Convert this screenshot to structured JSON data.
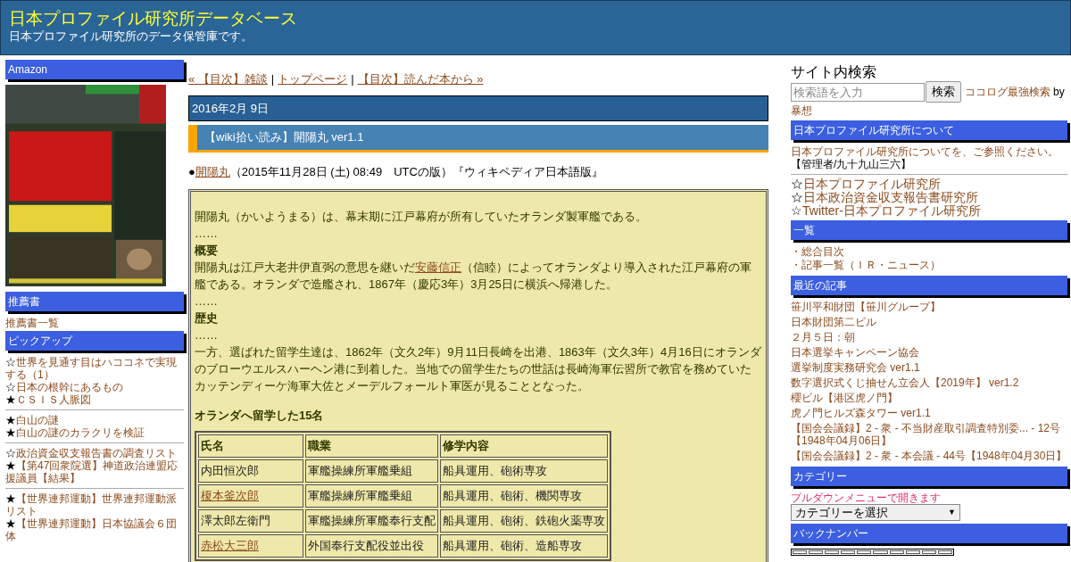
{
  "header": {
    "title": "日本プロファイル研究所データベース",
    "subtitle": "日本プロファイル研究所のデータ保管庫です。"
  },
  "left": {
    "sections": [
      {
        "heading": "Amazon",
        "kind": "picture"
      },
      {
        "heading": "推薦書",
        "kind": "links",
        "groups": [
          [
            {
              "text": "推薦書一覧"
            }
          ]
        ]
      },
      {
        "heading": "ピックアップ",
        "kind": "links",
        "groups": [
          [
            {
              "mark": "☆",
              "text": "世界を見通す目はハココネで実現する（1）"
            },
            {
              "mark": "☆",
              "text": "日本の根幹にあるもの"
            },
            {
              "mark": "★",
              "text": "ＣＳＩＳ人脈図"
            }
          ],
          [
            {
              "mark": "★",
              "text": "白山の謎"
            },
            {
              "mark": "★",
              "text": "白山の謎のカラクリを検証"
            }
          ],
          [
            {
              "mark": "☆",
              "text": "政治資金収支報告書の調査リスト"
            },
            {
              "mark": "★",
              "text": "【第47回衆院選】神道政治連盟応援議員【結果】"
            }
          ],
          [
            {
              "mark": "★",
              "text": "【世界連邦運動】世界連邦運動派リスト"
            },
            {
              "mark": "★",
              "text": "【世界連邦運動】日本協議会６団体"
            }
          ]
        ]
      }
    ]
  },
  "main": {
    "nav": {
      "separator": "|",
      "links": [
        "« 【目次】雑談",
        "トップページ",
        "【目次】読んだ本から »"
      ]
    },
    "date": "2016年2月 9日",
    "entry_title": "【wiki拾い読み】開陽丸 ver1.1",
    "source": {
      "bullet": "●",
      "link": "開陽丸",
      "rest": "（2015年11月28日 (土) 08:49　UTCの版）『ウィキペディア日本語版』"
    },
    "quote": [
      {
        "kind": "gap"
      },
      {
        "kind": "text",
        "parts": [
          {
            "text": "開陽丸（かいようまる）は、幕末期に江戸幕府が所有していたオランダ製軍艦である。",
            "link": false
          }
        ]
      },
      {
        "kind": "text",
        "parts": [
          {
            "text": "……",
            "link": false
          }
        ]
      },
      {
        "kind": "heading",
        "text": "概要"
      },
      {
        "kind": "text",
        "parts": [
          {
            "text": "開陽丸は江戸大老井伊直弼の意思を継いだ",
            "link": false
          },
          {
            "text": "安藤信正",
            "link": true
          },
          {
            "text": "（信睦）によってオランダより導入された江戸幕府の軍艦である。オランダで造艦され、1867年（慶応3年）3月25日に横浜へ帰港した。",
            "link": false
          }
        ]
      },
      {
        "kind": "text",
        "parts": [
          {
            "text": "……",
            "link": false
          }
        ]
      },
      {
        "kind": "heading",
        "text": "歴史"
      },
      {
        "kind": "text",
        "parts": [
          {
            "text": "……",
            "link": false
          }
        ]
      },
      {
        "kind": "text",
        "parts": [
          {
            "text": "一方、選ばれた留学生達は、1862年（文久2年）9月11日長崎を出港、1863年（文久3年）4月16日にオランダのブローウエルスハーヘン港に到着した。当地での留学生たちの世話は長崎海軍伝習所で教官を務めていたカッテンディーケ海軍大佐とメーデルフォールト軍医が見ることとなった。",
            "link": false
          }
        ]
      },
      {
        "kind": "gap"
      },
      {
        "kind": "heading",
        "text": "オランダへ留学した15名"
      },
      {
        "kind": "table",
        "columns": [
          "氏名",
          "職業",
          "修学内容"
        ],
        "rows": [
          [
            {
              "text": "内田恒次郎",
              "link": false
            },
            {
              "text": "軍艦操練所軍艦乗組",
              "link": false
            },
            {
              "text": "船具運用、砲術専攻",
              "link": false
            }
          ],
          [
            {
              "text": "榎本釜次郎",
              "link": true
            },
            {
              "text": "軍艦操練所軍艦乗組",
              "link": false
            },
            {
              "text": "船具運用、砲術、機関専攻",
              "link": false
            }
          ],
          [
            {
              "text": "澤太郎左衛門",
              "link": false
            },
            {
              "text": "軍艦操練所軍艦奉行支配",
              "link": false
            },
            {
              "text": "船具運用、砲術、鉄砲火薬専攻",
              "link": false
            }
          ],
          [
            {
              "text": "赤松大三郎",
              "link": true
            },
            {
              "text": "外国奉行支配役並出役",
              "link": false
            },
            {
              "text": "船具運用、砲術、造船専攻",
              "link": false
            }
          ]
        ]
      }
    ]
  },
  "right": {
    "search": {
      "title": "サイト内検索",
      "placeholder": "検索語を入力",
      "button": "検索",
      "credit_link": "ココログ最強検索",
      "credit_by": "by",
      "credit_author": "暴想"
    },
    "about": {
      "heading": "日本プロファイル研究所について",
      "link": "日本プロファイル研究所について",
      "text": "を、ご参照ください。",
      "admin": "【管理者/九十九山三六】"
    },
    "sites": [
      {
        "mark": "☆",
        "text": "日本プロファイル研究所"
      },
      {
        "mark": "☆",
        "text": "日本政治資金収支報告書研究所"
      },
      {
        "mark": "☆",
        "text": "Twitter-日本プロファイル研究所"
      }
    ],
    "index": {
      "heading": "一覧",
      "items": [
        "・総合目次",
        "・記事一覧（ＩＲ・ニュース）"
      ]
    },
    "recent": {
      "heading": "最近の記事",
      "items": [
        "笹川平和財団【笹川グループ】",
        "日本財団第二ビル",
        "２月５日：朝",
        "日本選挙キャンペーン協会",
        "選挙制度実務研究会 ver1.1",
        "数字選択式くじ抽せん立会人【2019年】 ver1.2",
        "櫻ビル【港区虎ノ門】",
        "虎ノ門ヒルズ森タワー ver1.1",
        "【国会会議録】2 - 衆 - 不当財産取引調査特別委... - 12号【1948年04月06日】",
        "【国会会議録】2 - 衆 - 本会議 - 44号【1948年04月30日】"
      ]
    },
    "category": {
      "heading": "カテゴリー",
      "note": "プルダウンメニューで開きます",
      "select": "カテゴリーを選択",
      "arrow": "▼"
    },
    "backnumber": {
      "heading": "バックナンバー"
    }
  }
}
